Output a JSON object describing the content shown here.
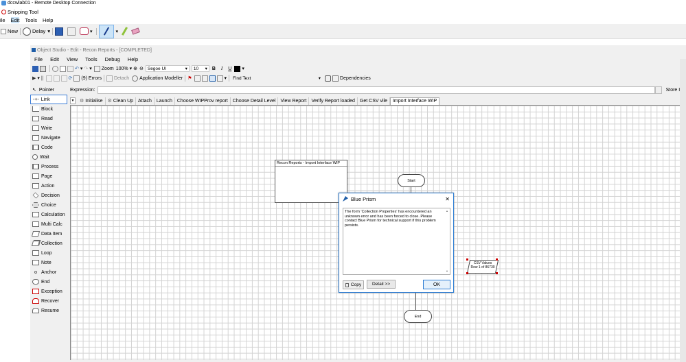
{
  "rd_title": "dccwlab01 - Remote Desktop Connection",
  "snip": {
    "title": "Snipping Tool",
    "menu": [
      "ile",
      "Edit",
      "Tools",
      "Help"
    ],
    "new_label": "New",
    "delay_label": "Delay"
  },
  "bp": {
    "title": "Object Studio - Edit - Recon Reports - [COMPLETED]",
    "menu": [
      "File",
      "Edit",
      "View",
      "Tools",
      "Debug",
      "Help"
    ],
    "toolbar1": {
      "zoom_label": "Zoom",
      "zoom_value": "100%",
      "font": "Segoe UI",
      "size": "10",
      "bold": "B",
      "italic": "I",
      "underline": "U"
    },
    "toolbar2": {
      "errors": "(9) Errors",
      "detach": "Detach",
      "app_modeller": "Application Modeller",
      "find_text": "Find Text",
      "dependencies": "Dependencies"
    },
    "expression_label": "Expression:",
    "store_in_label": "Store In:",
    "tabs": [
      "Initialise",
      "Clean Up",
      "Attach",
      "Launch",
      "Choose WIPProv report",
      "Choose Detail Level",
      "View Report",
      "Verify Report loaded",
      "Get CSV vile",
      "Import Interface WIP"
    ],
    "palette": [
      "Pointer",
      "Link",
      "Block",
      "Read",
      "Write",
      "Navigate",
      "Code",
      "Wait",
      "Process",
      "Page",
      "Action",
      "Decision",
      "Choice",
      "Calculation",
      "Multi Calc",
      "Data Item",
      "Collection",
      "Loop",
      "Note",
      "Anchor",
      "End",
      "Exception",
      "Recover",
      "Resume"
    ]
  },
  "canvas": {
    "page_label": "Recon Reports - Import Interface WIP",
    "start_label": "Start",
    "end_label": "End",
    "csv_line1": "CSV Values",
    "csv_line2": "Row 1 of 86730"
  },
  "dialog": {
    "title": "Blue Prism",
    "close": "✕",
    "message": "The form 'Collection Properties' has encountered an unknown error and has been forced to close. Please contact Blue Prism for technical support if this problem persists.",
    "copy": "Copy",
    "detail": "Detail >>",
    "ok": "OK"
  },
  "colors": {
    "accent": "#2b7cd3",
    "exception": "#cc0000",
    "grid": "#d3d3d3"
  }
}
